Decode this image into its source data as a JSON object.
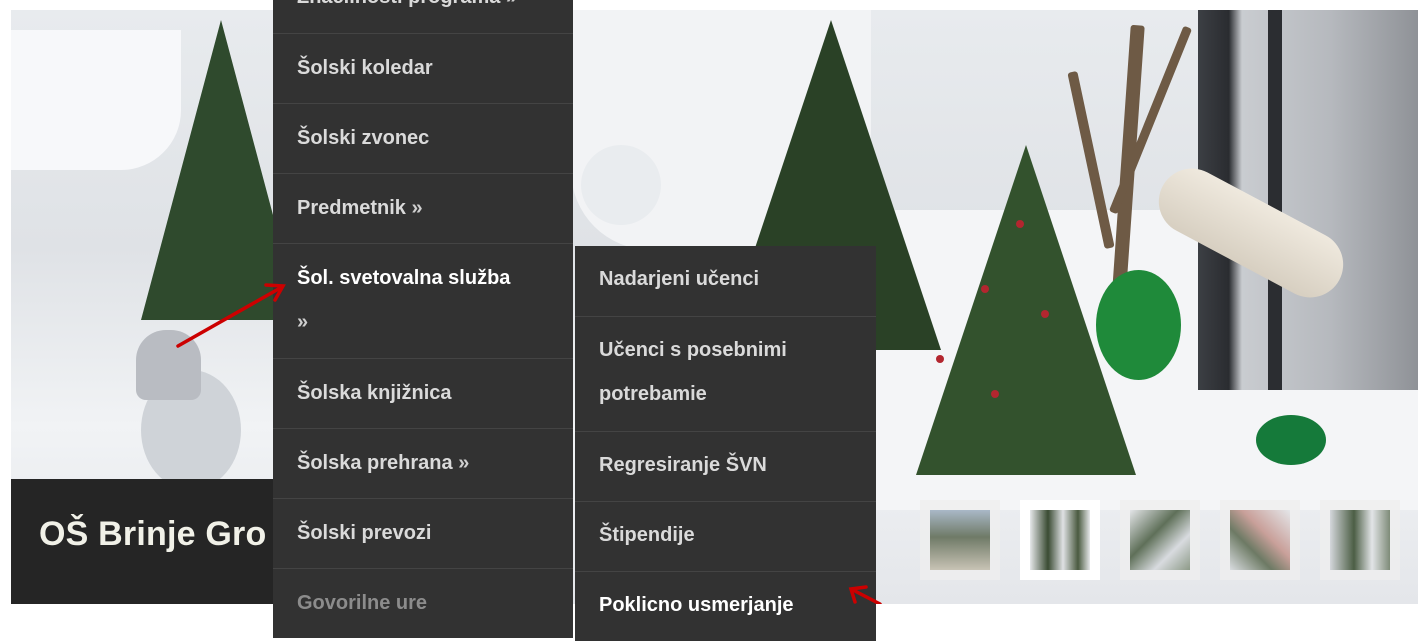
{
  "hero": {
    "title": "OŠ Brinje Gro"
  },
  "menu_primary": {
    "items": [
      {
        "label": "Značilnosti programa",
        "arrow": "»"
      },
      {
        "label": "Šolski koledar",
        "arrow": ""
      },
      {
        "label": "Šolski zvonec",
        "arrow": ""
      },
      {
        "label": "Predmetnik",
        "arrow": "»"
      },
      {
        "label": "Šol. svetovalna služba",
        "arrow": "»"
      },
      {
        "label": "Šolska knjižnica",
        "arrow": ""
      },
      {
        "label": "Šolska prehrana",
        "arrow": "»"
      },
      {
        "label": "Šolski prevozi",
        "arrow": ""
      },
      {
        "label": "Govorilne ure",
        "arrow": ""
      }
    ]
  },
  "menu_sub": {
    "items": [
      {
        "label": "Nadarjeni učenci"
      },
      {
        "label": "Učenci s posebnimi potrebamie"
      },
      {
        "label": "Regresiranje ŠVN"
      },
      {
        "label": "Štipendije"
      },
      {
        "label": "Poklicno usmerjanje"
      }
    ]
  },
  "thumbnails": {
    "count": 5,
    "active_index": 1
  },
  "colors": {
    "menu_bg": "#323232",
    "menu_text": "#dadada",
    "annotation_arrow": "#cc0000"
  }
}
